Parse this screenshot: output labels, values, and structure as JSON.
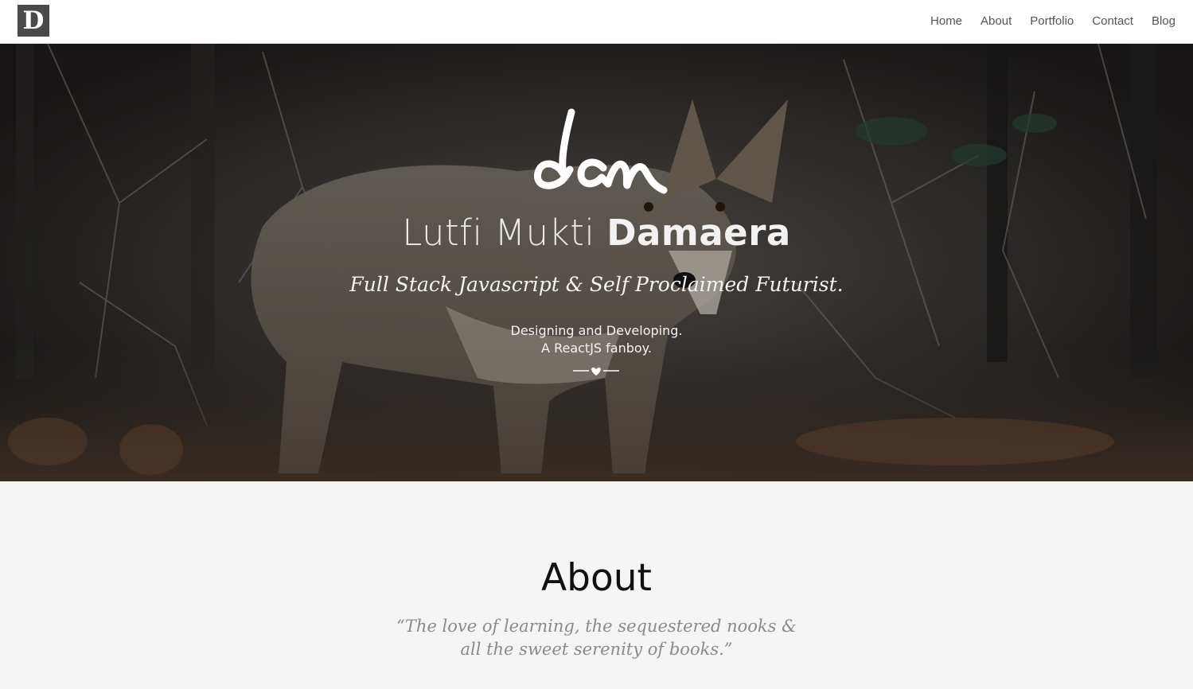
{
  "navbar": {
    "brand_letter": "D",
    "links": [
      {
        "label": "Home"
      },
      {
        "label": "About"
      },
      {
        "label": "Portfolio"
      },
      {
        "label": "Contact"
      },
      {
        "label": "Blog"
      }
    ]
  },
  "hero": {
    "logo_text": "dam",
    "name_first": "Lutfi Mukti",
    "name_last": "Damaera",
    "tagline": "Full Stack Javascript & Self Proclaimed Futurist.",
    "subline_1": "Designing and Developing.",
    "subline_2": "A ReactJS fanboy.",
    "background_image": "coyote-in-forest"
  },
  "about": {
    "title": "About",
    "quote_line_1": "“The love of learning, the sequestered nooks &",
    "quote_line_2": "all the sweet serenity of books.”"
  },
  "colors": {
    "navbar_bg": "#ffffff",
    "nav_link": "#555555",
    "brand_bg": "#4a4a4a",
    "about_bg": "#f5f5f5",
    "about_title": "#111111",
    "about_quote": "#8a8a8a"
  }
}
